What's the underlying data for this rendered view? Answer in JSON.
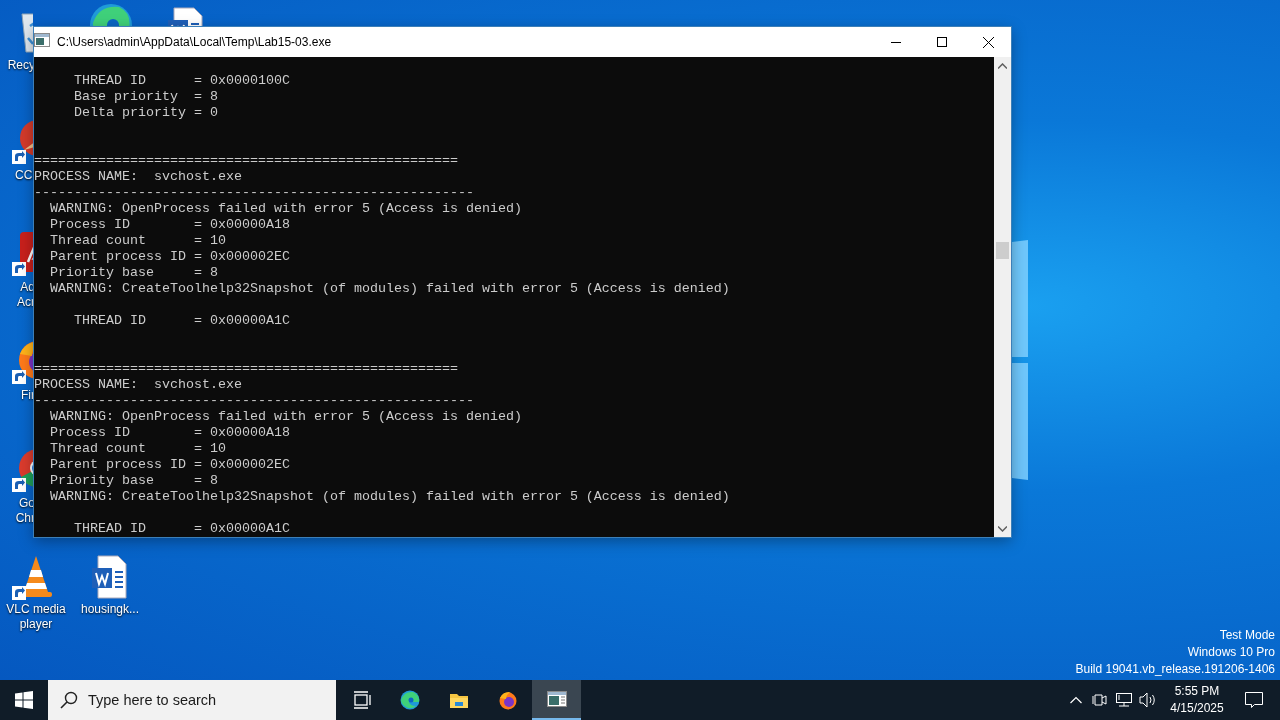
{
  "desktop": {
    "icons": [
      {
        "kind": "recycle-bin",
        "label_lines": [
          "Recy"
        ]
      },
      {
        "kind": "edge"
      },
      {
        "kind": "word"
      },
      {
        "kind": "ccleaner",
        "label_lines": [
          "CCl"
        ]
      },
      {
        "kind": "acrobat",
        "label_lines": [
          "Ad",
          "Acr"
        ]
      },
      {
        "kind": "firefox",
        "label_lines": [
          "Fir"
        ]
      },
      {
        "kind": "chrome",
        "label_lines": [
          "Go",
          "Chr"
        ]
      },
      {
        "kind": "vlc",
        "label_lines": [
          "VLC media",
          "player"
        ]
      },
      {
        "kind": "word",
        "label_lines": [
          "housingk..."
        ]
      }
    ],
    "system_notice": [
      "Test Mode",
      "Windows 10 Pro",
      "Build 19041.vb_release.191206-1406"
    ]
  },
  "console_window": {
    "title": "C:\\Users\\admin\\AppData\\Local\\Temp\\Lab15-03.exe",
    "lines": [
      {
        "kind": "blank"
      },
      {
        "kind": "text",
        "text": "     THREAD ID      = 0x0000100C"
      },
      {
        "kind": "text",
        "text": "     Base priority  = 8"
      },
      {
        "kind": "text",
        "text": "     Delta priority = 0"
      },
      {
        "kind": "blank"
      },
      {
        "kind": "blank"
      },
      {
        "kind": "text",
        "text": "====================================================="
      },
      {
        "kind": "text",
        "text": "PROCESS NAME:  svchost.exe"
      },
      {
        "kind": "text",
        "text": "-------------------------------------------------------"
      },
      {
        "kind": "text",
        "text": "  WARNING: OpenProcess failed with error 5 (Access is denied)"
      },
      {
        "kind": "text",
        "text": "  Process ID        = 0x00000A18"
      },
      {
        "kind": "text",
        "text": "  Thread count      = 10"
      },
      {
        "kind": "text",
        "text": "  Parent process ID = 0x000002EC"
      },
      {
        "kind": "text",
        "text": "  Priority base     = 8"
      },
      {
        "kind": "text",
        "text": "  WARNING: CreateToolhelp32Snapshot (of modules) failed with error 5 (Access is denied)"
      },
      {
        "kind": "blank"
      },
      {
        "kind": "text",
        "text": "     THREAD ID      = 0x00000A1C"
      },
      {
        "kind": "blank"
      },
      {
        "kind": "blank"
      },
      {
        "kind": "text",
        "text": "====================================================="
      },
      {
        "kind": "text",
        "text": "PROCESS NAME:  svchost.exe"
      },
      {
        "kind": "text",
        "text": "-------------------------------------------------------"
      },
      {
        "kind": "text",
        "text": "  WARNING: OpenProcess failed with error 5 (Access is denied)"
      },
      {
        "kind": "text",
        "text": "  Process ID        = 0x00000A18"
      },
      {
        "kind": "text",
        "text": "  Thread count      = 10"
      },
      {
        "kind": "text",
        "text": "  Parent process ID = 0x000002EC"
      },
      {
        "kind": "text",
        "text": "  Priority base     = 8"
      },
      {
        "kind": "text",
        "text": "  WARNING: CreateToolhelp32Snapshot (of modules) failed with error 5 (Access is denied)"
      },
      {
        "kind": "blank"
      },
      {
        "kind": "text",
        "text": "     THREAD ID      = 0x00000A1C"
      }
    ]
  },
  "taskbar": {
    "search": {
      "placeholder": "Type here to search"
    },
    "apps": [
      {
        "kind": "task-view",
        "selected": false
      },
      {
        "kind": "edge",
        "selected": false
      },
      {
        "kind": "explorer",
        "selected": false
      },
      {
        "kind": "firefox",
        "selected": false
      },
      {
        "kind": "console",
        "selected": true
      }
    ],
    "clock": {
      "time": "5:55 PM",
      "date": "4/15/2025"
    }
  }
}
